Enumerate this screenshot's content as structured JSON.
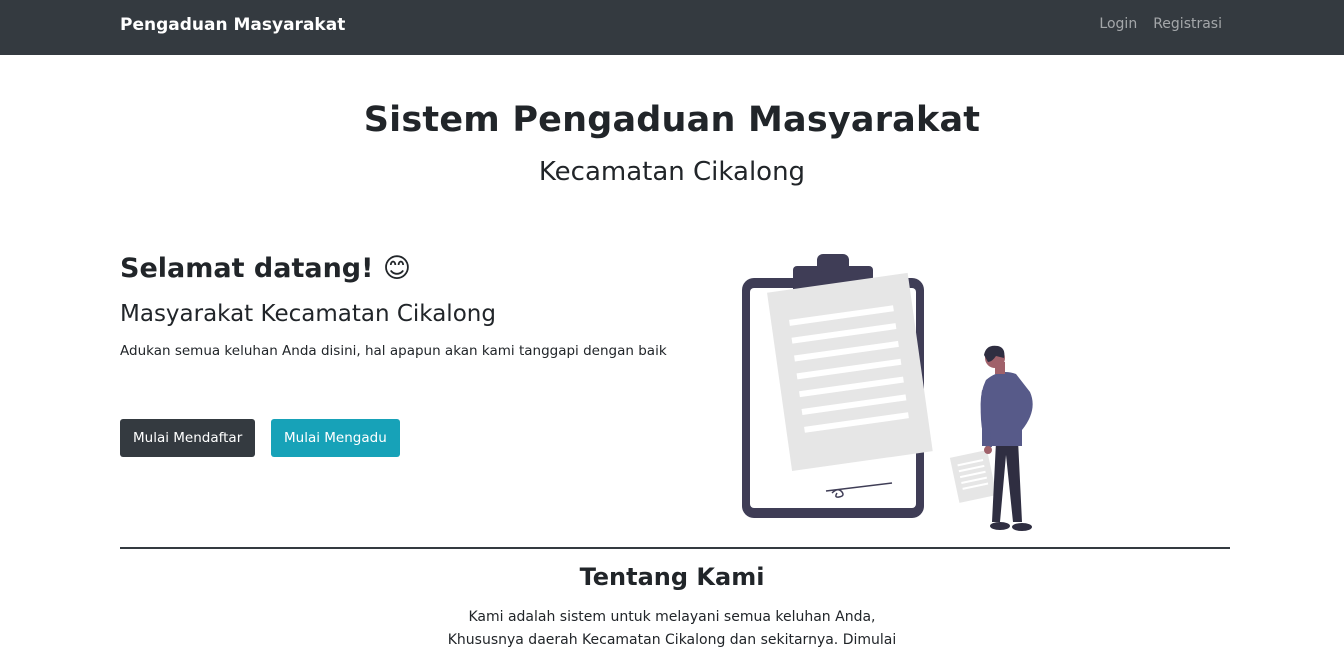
{
  "navbar": {
    "brand": "Pengaduan Masyarakat",
    "links": [
      "Login",
      "Registrasi"
    ]
  },
  "hero": {
    "title": "Sistem Pengaduan Masyarakat",
    "subtitle": "Kecamatan Cikalong"
  },
  "welcome": {
    "heading": "Selamat datang! 😊",
    "target": "Masyarakat Kecamatan Cikalong",
    "description": "Adukan semua keluhan Anda disini, hal apapun akan kami tanggapi dengan baik"
  },
  "buttons": {
    "register": "Mulai Mendaftar",
    "complain": "Mulai Mengadu"
  },
  "about": {
    "title": "Tentang Kami",
    "line1": "Kami adalah sistem untuk melayani semua keluhan Anda,",
    "line2": "Khususnya daerah Kecamatan Cikalong dan sekitarnya. Dimulai"
  },
  "colors": {
    "navbar": "#343a40",
    "primary_dark": "#343a40",
    "info": "#17a2b8",
    "illustration_dark": "#3f3d56",
    "illustration_shirt": "#575a89"
  },
  "illustration": {
    "icon": "clipboard-person-illustration"
  }
}
